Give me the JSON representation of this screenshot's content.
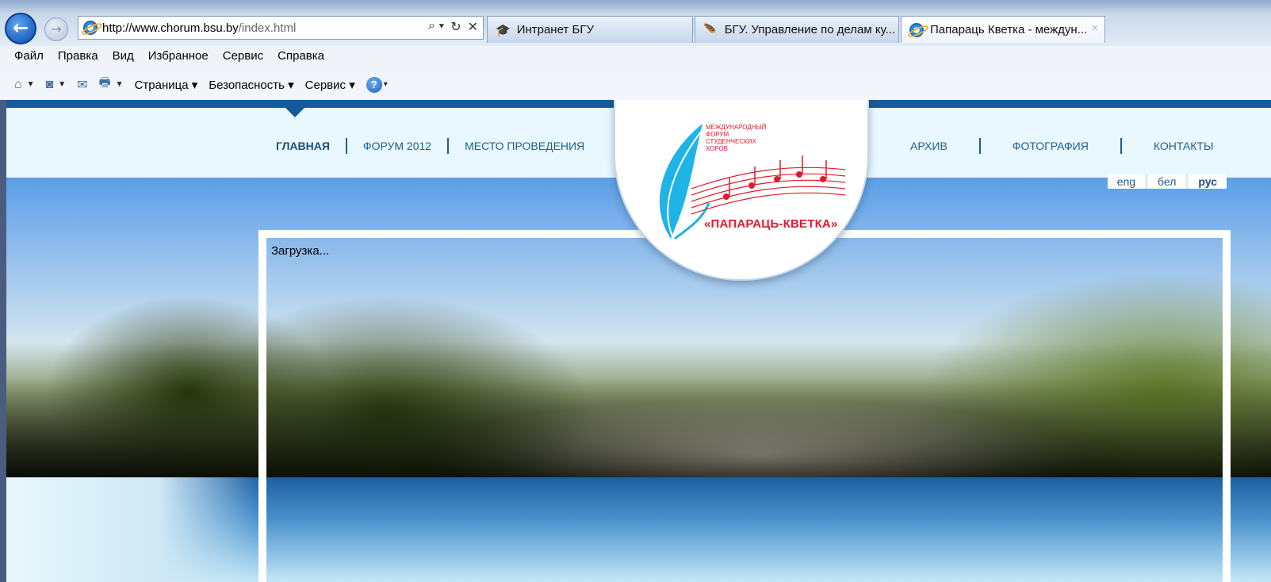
{
  "browser": {
    "back_label": "←",
    "forward_label": "→",
    "address": {
      "host": "http://www.chorum.bsu.by",
      "path": "/index.html"
    },
    "address_buttons": [
      "⌕ ▾",
      "↻",
      "✕"
    ],
    "tabs": [
      {
        "label": "Интранет БГУ",
        "icon": "🎓"
      },
      {
        "label": "БГУ. Управление по делам ку...",
        "icon": "🪶"
      },
      {
        "label": "Папараць Кветка - междун...",
        "icon": "e",
        "close": "×"
      }
    ],
    "menu": [
      "Файл",
      "Правка",
      "Вид",
      "Избранное",
      "Сервис",
      "Справка"
    ],
    "commands": {
      "home_icon": "⌂",
      "feeds_icon": "◙",
      "mail_icon": "✉",
      "print_icon": "🖶",
      "drop": "▼",
      "page": "Страница ▾",
      "safety": "Безопасность ▾",
      "tools": "Сервис ▾",
      "help": "?",
      "help_drop": "▾"
    }
  },
  "site": {
    "nav_left": [
      "ГЛАВНАЯ",
      "ФОРУМ 2012",
      "МЕСТО ПРОВЕДЕНИЯ"
    ],
    "nav_right": [
      "АРХИВ",
      "ФОТОГРАФИЯ",
      "КОНТАКТЫ"
    ],
    "languages": [
      "eng",
      "бел",
      "рус"
    ],
    "logo": {
      "lines": [
        "МЕЖДУНАРОДНЫЙ",
        "ФОРУМ",
        "СТУДЕНЧЕСКИХ",
        "ХОРОВ"
      ],
      "name": "«ПАПАРАЦЬ-КВЕТКА»"
    },
    "loading_text": "Загрузка..."
  }
}
